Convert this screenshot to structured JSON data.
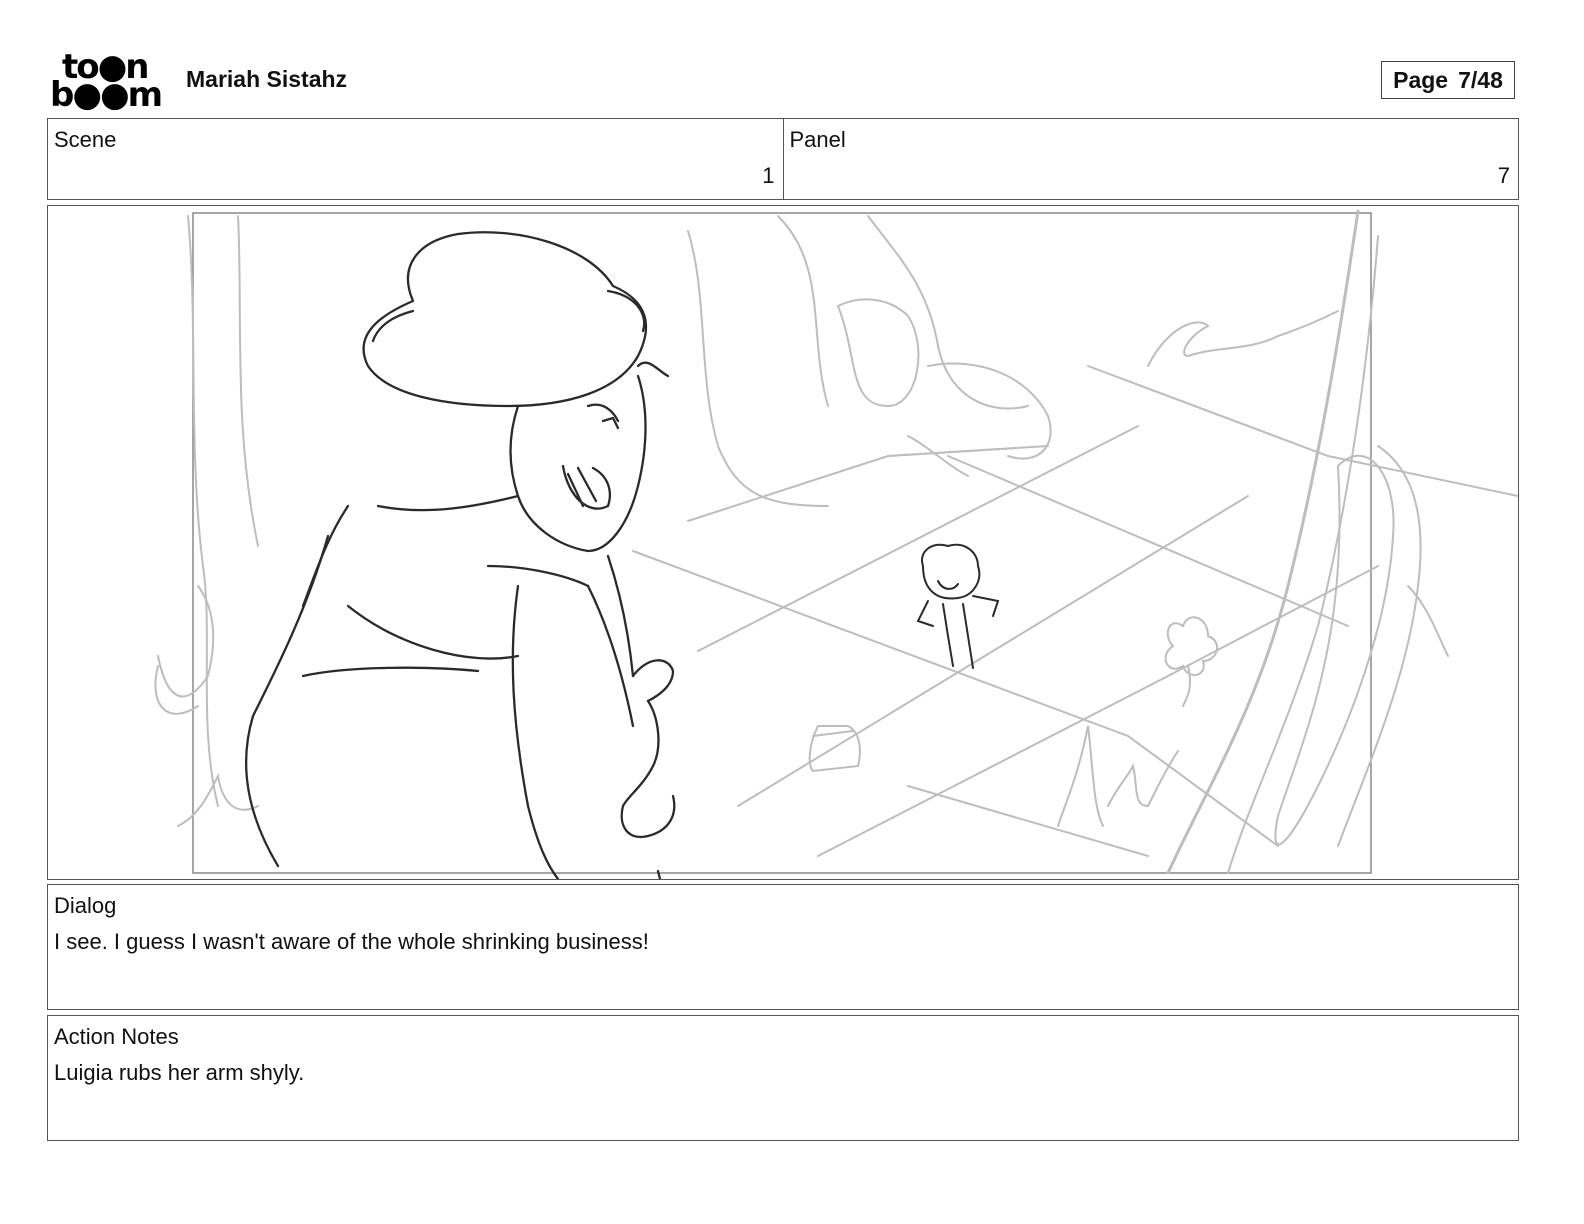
{
  "header": {
    "logo_line1": "to●n",
    "logo_line2": "b●●m",
    "project_title": "Mariah Sistahz",
    "page_label": "Page",
    "page_value": "7/48"
  },
  "info": {
    "scene_label": "Scene",
    "scene_value": "1",
    "panel_label": "Panel",
    "panel_value": "7"
  },
  "dialog": {
    "label": "Dialog",
    "text": "I see. I guess I wasn't aware of the whole shrinking business!"
  },
  "action_notes": {
    "label": "Action Notes",
    "text": "Luigia rubs her arm shyly."
  }
}
